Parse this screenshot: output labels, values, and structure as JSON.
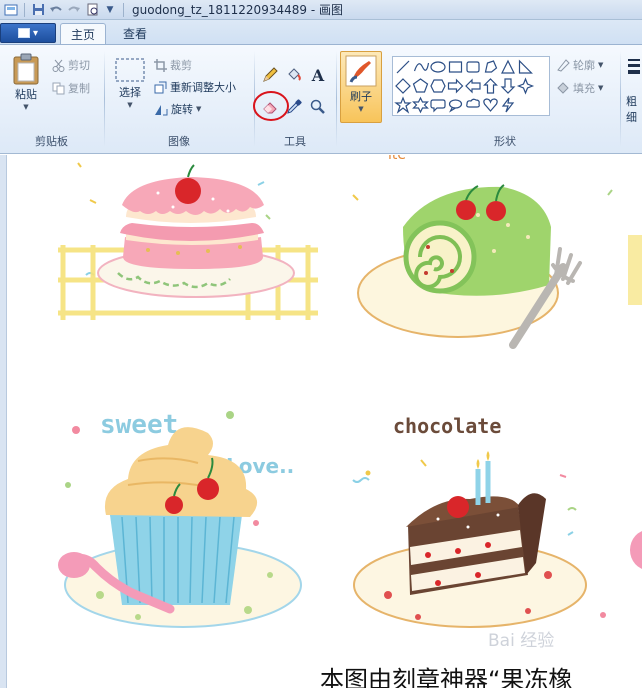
{
  "window": {
    "title": "guodong_tz_1811220934489 - 画图"
  },
  "tabs": {
    "home": "主页",
    "view": "查看"
  },
  "clipboard": {
    "paste": "粘贴",
    "cut": "剪切",
    "copy": "复制",
    "label": "剪贴板"
  },
  "image": {
    "select": "选择",
    "crop": "裁剪",
    "resize": "重新调整大小",
    "rotate": "旋转",
    "label": "图像"
  },
  "tools": {
    "label": "工具",
    "pencil": "pencil-icon",
    "fill": "fill-bucket-icon",
    "text": "A",
    "eraser": "eraser-icon",
    "color_picker": "color-picker-icon",
    "magnifier": "magnifier-icon",
    "highlight_color": "#d9141c"
  },
  "brushes": {
    "label": "刷子"
  },
  "shapes": {
    "outline": "轮廓",
    "fill": "填充",
    "label": "形状"
  },
  "side_cut": {
    "text1": "粗",
    "text2": "细"
  },
  "artwork": {
    "sweet": "sweet",
    "love": "Love..",
    "chocolate": "chocolate",
    "top_partial": "ite"
  },
  "overlay": {
    "caption": "本图由刻章神器“果冻橡",
    "watermark": "Bai 经验"
  }
}
